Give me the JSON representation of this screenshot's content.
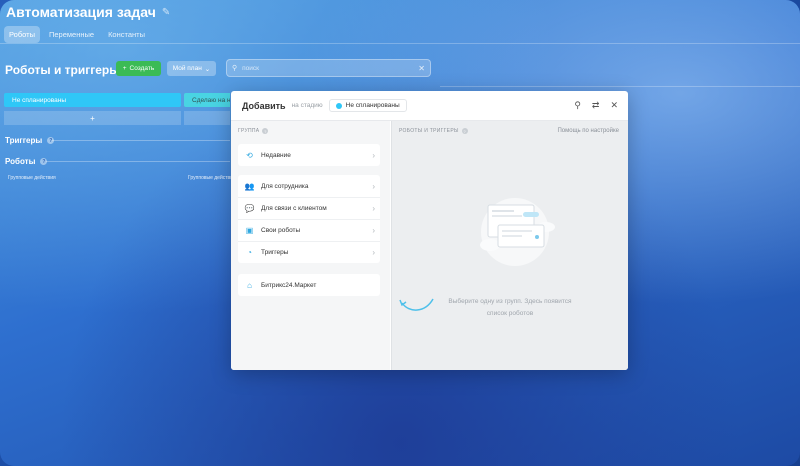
{
  "app": {
    "title": "Автоматизация задач"
  },
  "tabs": [
    "Роботы",
    "Переменные",
    "Константы"
  ],
  "page": {
    "heading": "Роботы и триггеры"
  },
  "toolbar": {
    "create_label": "Создать",
    "plan_label": "Мой план",
    "search_placeholder": "поиск"
  },
  "stages": [
    {
      "label": "Не спланированы",
      "color": "#2fc7f7"
    },
    {
      "label": "Сделаю на нед",
      "color": "#49d4e3"
    }
  ],
  "add_symbol": "+",
  "sections": {
    "triggers": "Триггеры",
    "robots": "Роботы"
  },
  "group_actions": [
    "Групповые действия",
    "Групповые действия"
  ],
  "modal": {
    "title": "Добавить",
    "stage_prefix": "на стадию",
    "stage_value": "Не спланированы",
    "left_header": "ГРУППА",
    "right_header": "РОБОТЫ И ТРИГГЕРЫ",
    "help_link": "Помощь по настройке",
    "groups": [
      {
        "label": "Недавние",
        "icon": "history-icon"
      },
      {
        "label": "Для сотрудника",
        "icon": "users-icon"
      },
      {
        "label": "Для связи с клиентом",
        "icon": "chat-icon"
      },
      {
        "label": "Свои роботы",
        "icon": "robot-icon"
      },
      {
        "label": "Триггеры",
        "icon": "trigger-icon"
      },
      {
        "label": "Битрикс24.Маркет",
        "icon": "market-icon"
      }
    ],
    "empty_line1": "Выберите одну из групп. Здесь появится",
    "empty_line2": "список роботов"
  }
}
